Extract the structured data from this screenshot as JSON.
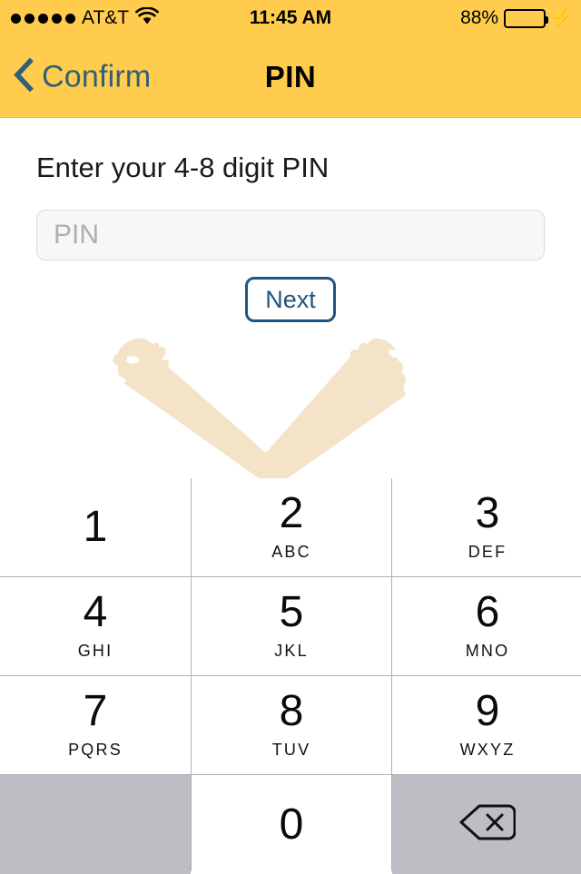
{
  "status_bar": {
    "signal_dots": 5,
    "carrier": "AT&T",
    "wifi_icon": "wifi-icon",
    "time": "11:45 AM",
    "battery_percent": "88%",
    "battery_level": 88,
    "battery_color": "#4CD964",
    "charging_icon": "lightning-bolt-icon"
  },
  "nav_bar": {
    "back_icon": "chevron-left-icon",
    "back_label": "Confirm",
    "title": "PIN",
    "background_color": "#FFCC4D",
    "tint_color": "#2F6079"
  },
  "content": {
    "prompt": "Enter your 4-8 digit PIN",
    "pin_field": {
      "value": "",
      "placeholder": "PIN"
    },
    "next_label": "Next",
    "next_color": "#1F5582",
    "watermark_icon": "checkmark-brushstroke-watermark",
    "watermark_color": "#F5E3C8"
  },
  "keypad": {
    "keys": [
      {
        "digit": "1",
        "letters": ""
      },
      {
        "digit": "2",
        "letters": "ABC"
      },
      {
        "digit": "3",
        "letters": "DEF"
      },
      {
        "digit": "4",
        "letters": "GHI"
      },
      {
        "digit": "5",
        "letters": "JKL"
      },
      {
        "digit": "6",
        "letters": "MNO"
      },
      {
        "digit": "7",
        "letters": "PQRS"
      },
      {
        "digit": "8",
        "letters": "TUV"
      },
      {
        "digit": "9",
        "letters": "WXYZ"
      },
      {
        "digit": "",
        "letters": ""
      },
      {
        "digit": "0",
        "letters": ""
      },
      {
        "digit": "",
        "letters": "",
        "icon": "delete-backspace-icon"
      }
    ],
    "key_background": "#FFFFFF",
    "special_key_background": "#BCBEC3",
    "separator_color": "#B0B0B0"
  }
}
